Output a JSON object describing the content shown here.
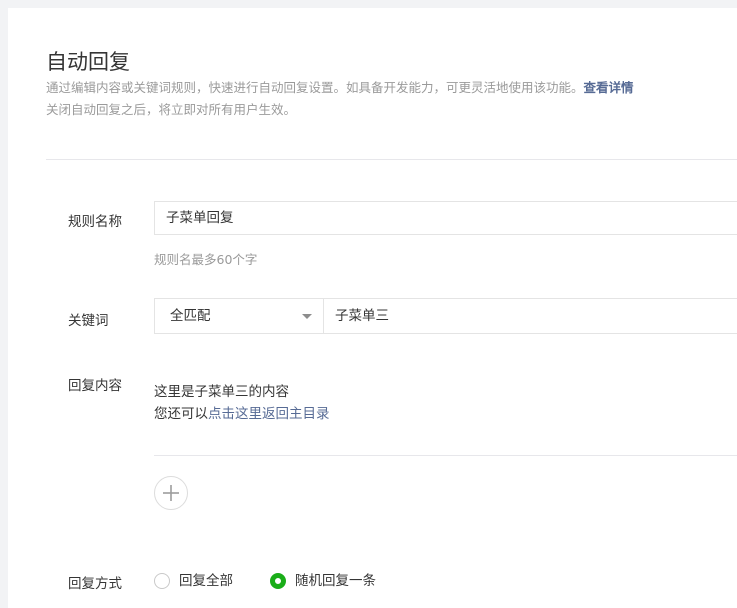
{
  "page": {
    "title": "自动回复",
    "description_line1": "通过编辑内容或关键词规则，快速进行自动回复设置。如具备开发能力，可更灵活地使用该功能。",
    "details_link": "查看详情",
    "description_line2": "关闭自动回复之后，将立即对所有用户生效。"
  },
  "form": {
    "rule_name": {
      "label": "规则名称",
      "value": "子菜单回复",
      "hint": "规则名最多60个字"
    },
    "keyword": {
      "label": "关键词",
      "match_mode": "全匹配",
      "value": "子菜单三"
    },
    "reply_content": {
      "label": "回复内容",
      "line1": "这里是子菜单三的内容",
      "line2_prefix": "您还可以",
      "line2_link": "点击这里返回主目录"
    },
    "reply_mode": {
      "label": "回复方式",
      "options": [
        {
          "label": "回复全部",
          "checked": false
        },
        {
          "label": "随机回复一条",
          "checked": true
        }
      ]
    }
  },
  "colors": {
    "accent_green": "#1aad19",
    "link_blue": "#576b95"
  },
  "icons": {
    "add": "plus-icon",
    "dropdown": "caret-down-icon"
  }
}
